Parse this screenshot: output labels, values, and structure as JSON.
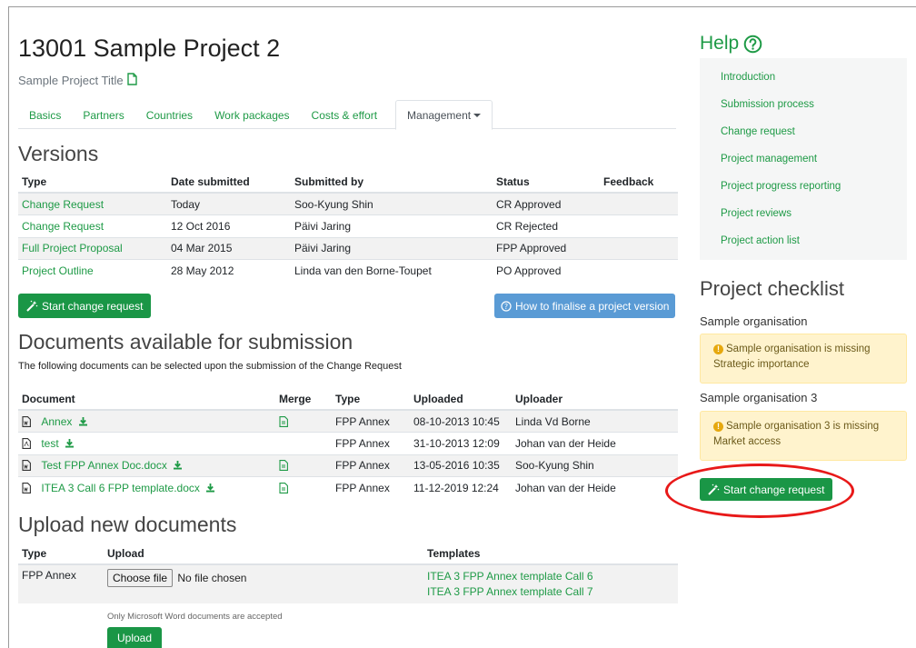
{
  "project": {
    "title": "13001 Sample Project 2",
    "subtitle": "Sample Project Title"
  },
  "tabs": [
    {
      "label": "Basics"
    },
    {
      "label": "Partners"
    },
    {
      "label": "Countries"
    },
    {
      "label": "Work packages"
    },
    {
      "label": "Costs & effort"
    },
    {
      "label": "Management"
    }
  ],
  "versions": {
    "heading": "Versions",
    "columns": [
      "Type",
      "Date submitted",
      "Submitted by",
      "Status",
      "Feedback"
    ],
    "rows": [
      {
        "type": "Change Request",
        "date": "Today",
        "by": "Soo-Kyung Shin",
        "status": "CR Approved",
        "feedback": ""
      },
      {
        "type": "Change Request",
        "date": "12 Oct 2016",
        "by": "Päivi Jaring",
        "status": "CR Rejected",
        "feedback": ""
      },
      {
        "type": "Full Project Proposal",
        "date": "04 Mar 2015",
        "by": "Päivi Jaring",
        "status": "FPP Approved",
        "feedback": ""
      },
      {
        "type": "Project Outline",
        "date": "28 May 2012",
        "by": "Linda van den Borne-Toupet",
        "status": "PO Approved",
        "feedback": ""
      }
    ],
    "start_change_label": "Start change request",
    "finalise_label": "How to finalise a project version"
  },
  "documents": {
    "heading": "Documents available for submission",
    "intro": "The following documents can be selected upon the submission of the Change Request",
    "columns": [
      "Document",
      "Merge",
      "Type",
      "Uploaded",
      "Uploader"
    ],
    "rows": [
      {
        "name": "Annex",
        "merge": true,
        "type": "FPP Annex",
        "uploaded": "08-10-2013 10:45",
        "uploader": "Linda Vd Borne"
      },
      {
        "name": "test",
        "merge": false,
        "type": "FPP Annex",
        "uploaded": "31-10-2013 12:09",
        "uploader": "Johan van der Heide"
      },
      {
        "name": "Test FPP Annex Doc.docx",
        "merge": true,
        "type": "FPP Annex",
        "uploaded": "13-05-2016 10:35",
        "uploader": "Soo-Kyung Shin"
      },
      {
        "name": "ITEA 3 Call 6 FPP template.docx",
        "merge": true,
        "type": "FPP Annex",
        "uploaded": "11-12-2019 12:24",
        "uploader": "Johan van der Heide"
      }
    ]
  },
  "upload": {
    "heading": "Upload new documents",
    "columns": [
      "Type",
      "Upload",
      "Templates"
    ],
    "row_type": "FPP Annex",
    "choose_file": "Choose file",
    "no_file": "No file chosen",
    "templates": [
      "ITEA 3 FPP Annex template Call 6",
      "ITEA 3 FPP Annex template Call 7"
    ],
    "note": "Only Microsoft Word documents are accepted",
    "upload_label": "Upload"
  },
  "help": {
    "title": "Help",
    "items": [
      "Introduction",
      "Submission process",
      "Change request",
      "Project management",
      "Project progress reporting",
      "Project reviews",
      "Project action list"
    ]
  },
  "checklist": {
    "title": "Project checklist",
    "orgs": [
      {
        "name": "Sample organisation",
        "warning": "Sample organisation is missing Strategic importance"
      },
      {
        "name": "Sample organisation 3",
        "warning": "Sample organisation 3 is missing Market access"
      }
    ],
    "start_change_label": "Start change request"
  },
  "colors": {
    "accent_green": "#1a9646",
    "link_green": "#1e9a46",
    "info_blue": "#5a9bd5",
    "warning_bg": "#fff3cd",
    "highlight_red": "#e81919"
  }
}
